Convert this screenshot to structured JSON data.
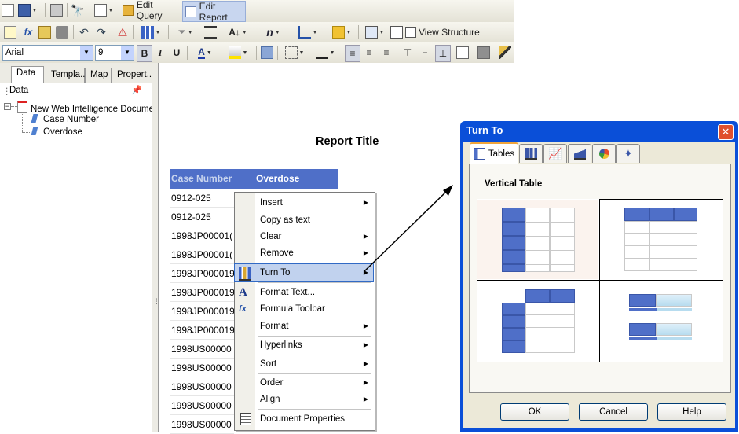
{
  "toolbar1": {
    "edit_query_label": "Edit Query",
    "edit_report_label": "Edit Report"
  },
  "toolbar2": {
    "view_structure_label": "View Structure"
  },
  "toolbar3": {
    "font_name": "Arial",
    "font_size": "9"
  },
  "left_panel": {
    "tabs": [
      "Data",
      "Templa...",
      "Map",
      "Propert..."
    ],
    "header": "Data",
    "tree_root": "New Web Intelligence Document",
    "tree_items": [
      "Case Number",
      "Overdose"
    ]
  },
  "report": {
    "title": "Report Title",
    "columns": [
      "Case Number",
      "Overdose"
    ],
    "rows": [
      "0912-025",
      "0912-025",
      "1998JP00001(",
      "1998JP00001(",
      "1998JP000019",
      "1998JP000019",
      "1998JP000019",
      "1998JP000019",
      "1998US00000",
      "1998US00000",
      "1998US00000",
      "1998US00000",
      "1998US00000"
    ]
  },
  "context_menu": {
    "items": {
      "insert": "Insert",
      "copy_as_text": "Copy as text",
      "clear": "Clear",
      "remove": "Remove",
      "turn_to": "Turn To",
      "format_text": "Format Text...",
      "formula_toolbar": "Formula Toolbar",
      "format": "Format",
      "hyperlinks": "Hyperlinks",
      "sort": "Sort",
      "order": "Order",
      "align": "Align",
      "document_properties": "Document Properties"
    }
  },
  "dialog": {
    "title": "Turn To",
    "close_glyph": "✕",
    "tabs": [
      "Tables"
    ],
    "section_label": "Vertical Table",
    "buttons": {
      "ok": "OK",
      "cancel": "Cancel",
      "help": "Help"
    }
  },
  "colors": {
    "header_blue": "#4f6fc8",
    "dialog_titlebar": "#0a4fd8",
    "menu_highlight": "#c1d2ee"
  }
}
